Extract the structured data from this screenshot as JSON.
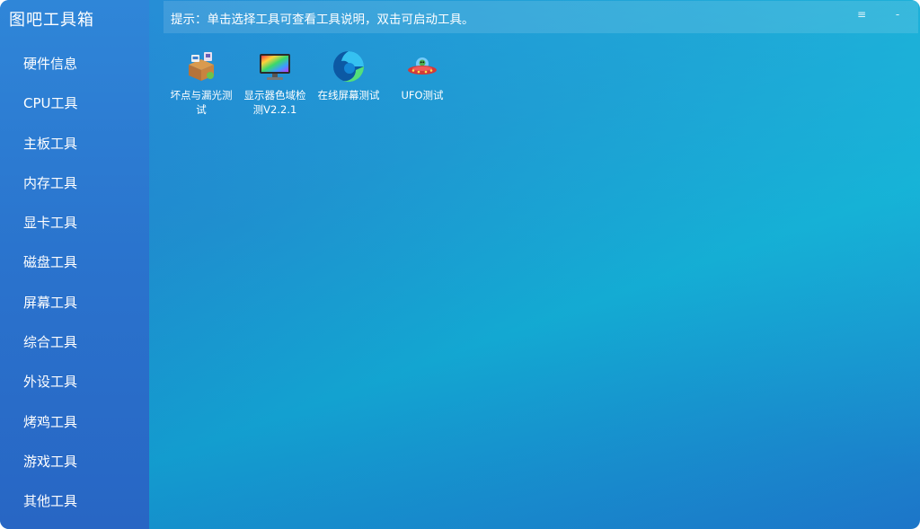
{
  "app": {
    "title": "图吧工具箱"
  },
  "hint": "提示：单击选择工具可查看工具说明，双击可启动工具。",
  "window_controls": {
    "menu": "≡",
    "minimize": "-"
  },
  "sidebar": {
    "items": [
      {
        "label": "硬件信息"
      },
      {
        "label": "CPU工具"
      },
      {
        "label": "主板工具"
      },
      {
        "label": "内存工具"
      },
      {
        "label": "显卡工具"
      },
      {
        "label": "磁盘工具"
      },
      {
        "label": "屏幕工具"
      },
      {
        "label": "综合工具"
      },
      {
        "label": "外设工具"
      },
      {
        "label": "烤鸡工具"
      },
      {
        "label": "游戏工具"
      },
      {
        "label": "其他工具"
      }
    ]
  },
  "tools": [
    {
      "label": "坏点与漏光测试",
      "icon": "box-tools-icon"
    },
    {
      "label": "显示器色域检测V2.2.1",
      "icon": "monitor-color-icon"
    },
    {
      "label": "在线屏幕测试",
      "icon": "edge-browser-icon"
    },
    {
      "label": "UFO测试",
      "icon": "ufo-icon"
    }
  ],
  "colors": {
    "sidebar": "#2a73cd",
    "background_start": "#2a79d4",
    "background_mid": "#13a9d2",
    "text": "#ffffff"
  }
}
